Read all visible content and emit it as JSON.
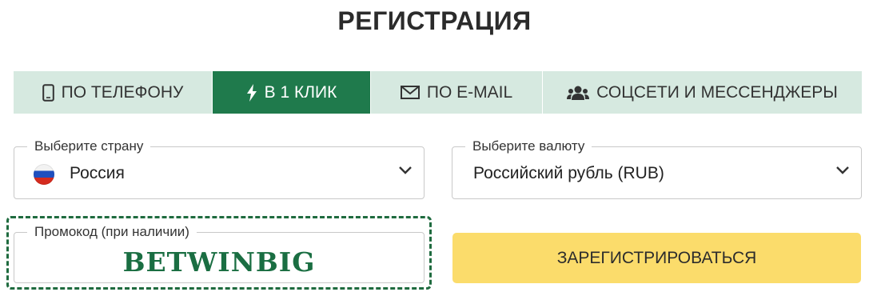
{
  "header": {
    "title": "РЕГИСТРАЦИЯ"
  },
  "tabs": [
    {
      "label": "ПО ТЕЛЕФОНУ",
      "icon": "phone-icon",
      "active": false
    },
    {
      "label": "В 1 КЛИК",
      "icon": "lightning-icon",
      "active": true
    },
    {
      "label": "ПО E-MAIL",
      "icon": "envelope-icon",
      "active": false
    },
    {
      "label": "СОЦСЕТИ И МЕССЕНДЖЕРЫ",
      "icon": "users-icon",
      "active": false
    }
  ],
  "country": {
    "label": "Выберите страну",
    "value": "Россия",
    "icon": "russia-flag-icon"
  },
  "currency": {
    "label": "Выберите валюту",
    "value": "Российский рубль (RUB)"
  },
  "promo": {
    "label": "Промокод (при наличии)",
    "value": "BETWINBIG"
  },
  "submit": {
    "label": "ЗАРЕГИСТРИРОВАТЬСЯ"
  },
  "colors": {
    "accent_green": "#1f7a4c",
    "tab_background": "#d6e9e0",
    "button_yellow": "#fbdc6b",
    "promo_green": "#1a6e42"
  }
}
